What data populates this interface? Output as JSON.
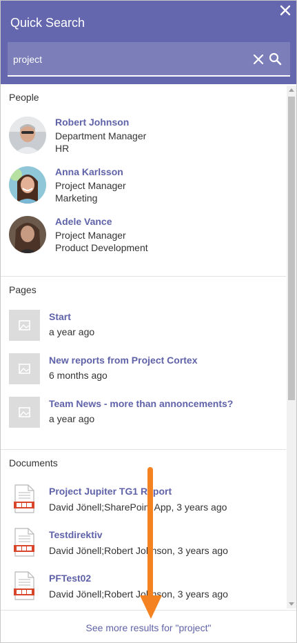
{
  "header": {
    "title": "Quick Search",
    "close_icon": "close-icon"
  },
  "search": {
    "value": "project",
    "clear_icon": "clear-icon",
    "search_icon": "search-icon"
  },
  "people": {
    "title": "People",
    "items": [
      {
        "name": "Robert Johnson",
        "role": "Department Manager",
        "dept": "HR"
      },
      {
        "name": "Anna Karlsson",
        "role": "Project Manager",
        "dept": "Marketing"
      },
      {
        "name": "Adele Vance",
        "role": "Project Manager",
        "dept": "Product Development"
      }
    ]
  },
  "pages": {
    "title": "Pages",
    "items": [
      {
        "title": "Start",
        "time": "a year ago"
      },
      {
        "title": "New reports from Project Cortex",
        "time": "6 months ago"
      },
      {
        "title": "Team News - more than annoncements?",
        "time": "a year ago"
      }
    ]
  },
  "documents": {
    "title": "Documents",
    "items": [
      {
        "title": "Project Jupiter TG1 Report",
        "meta": "David Jönell;SharePoint App, 3 years ago"
      },
      {
        "title": "Testdirektiv",
        "meta": "David Jönell;Robert Johnson, 3 years ago"
      },
      {
        "title": "PFTest02",
        "meta": "David Jönell;Robert Johnson, 3 years ago"
      }
    ]
  },
  "footer": {
    "more_link": "See more results for \"project\""
  },
  "colors": {
    "header": "#6467ad",
    "search_box": "#7b7eb9",
    "accent_text": "#5f62a8",
    "annotation_arrow": "#f58220",
    "doc_icon_red": "#d9452b"
  }
}
